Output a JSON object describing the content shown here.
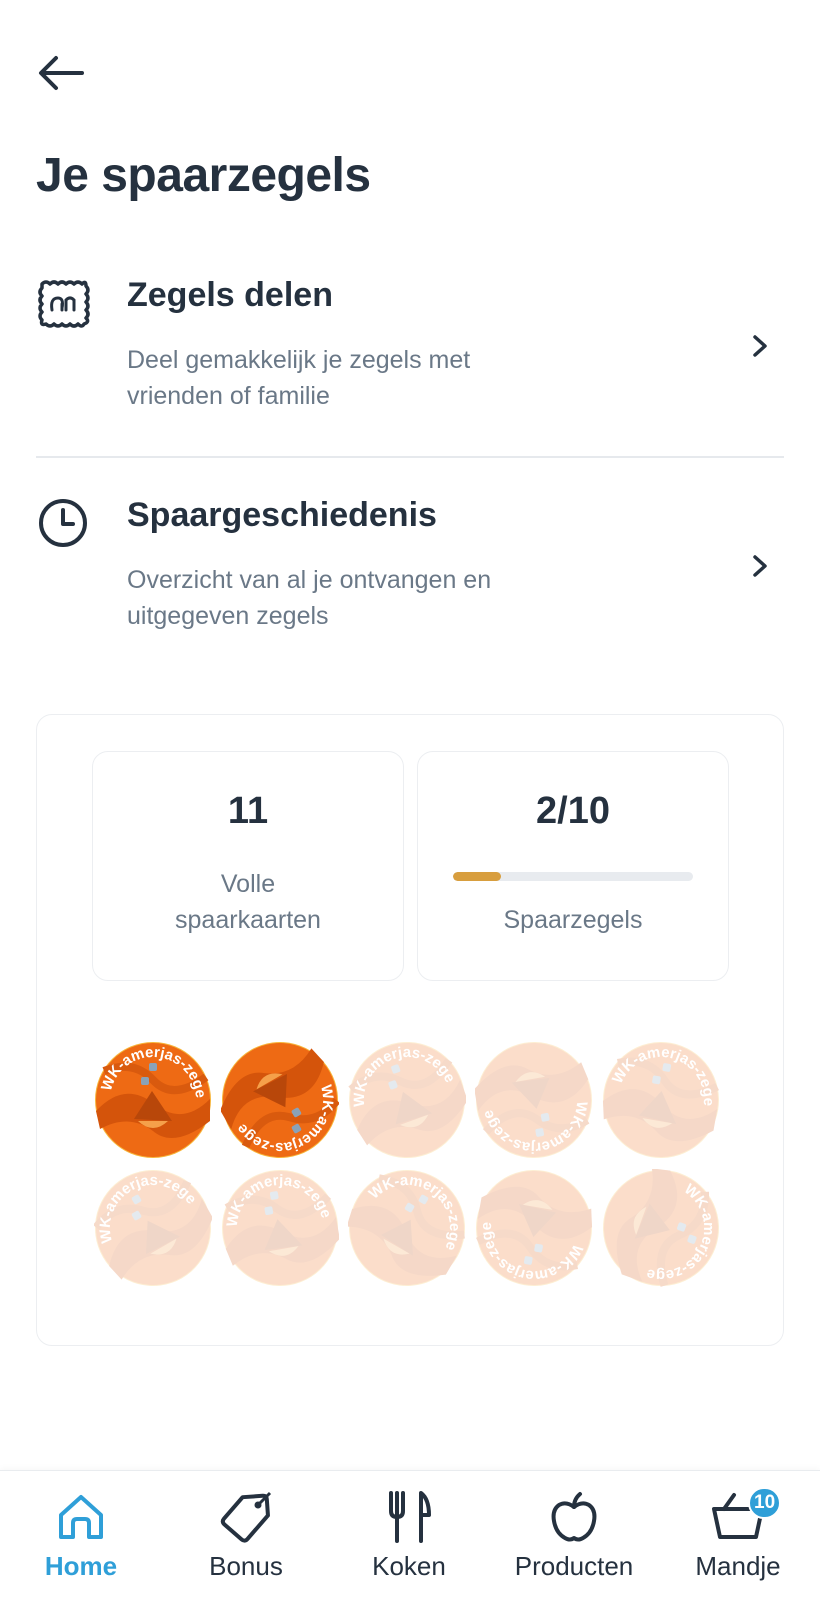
{
  "page": {
    "title": "Je spaarzegels"
  },
  "menu": {
    "share": {
      "title": "Zegels delen",
      "description": "Deel gemakkelijk je zegels met vrienden of familie",
      "icon": "ah-stamp-icon"
    },
    "history": {
      "title": "Spaargeschiedenis",
      "description": "Overzicht van al je ontvangen en uitgegeven zegels",
      "icon": "clock-icon"
    }
  },
  "stats": {
    "full_cards": {
      "value": "11",
      "label_line1": "Volle",
      "label_line2": "spaarkaarten"
    },
    "stamps": {
      "value": "2/10",
      "label": "Spaarzegels",
      "collected": 2,
      "total": 10,
      "progress": 0.2
    }
  },
  "stamp_card": {
    "stamp_text": "WK-amerjas-zegel",
    "collected": 2,
    "slots": 10
  },
  "tabbar": {
    "tabs": [
      {
        "label": "Home",
        "icon": "home-icon",
        "active": true
      },
      {
        "label": "Bonus",
        "icon": "tag-icon"
      },
      {
        "label": "Koken",
        "icon": "fork-knife-icon"
      },
      {
        "label": "Producten",
        "icon": "apple-icon"
      },
      {
        "label": "Mandje",
        "icon": "basket-icon",
        "badge": "10"
      }
    ]
  },
  "colors": {
    "accent": "#2f9fd8",
    "progress": "#d89e3e",
    "stamp_orange": "#f06a12",
    "text": "#25313f",
    "muted": "#6a7887"
  }
}
